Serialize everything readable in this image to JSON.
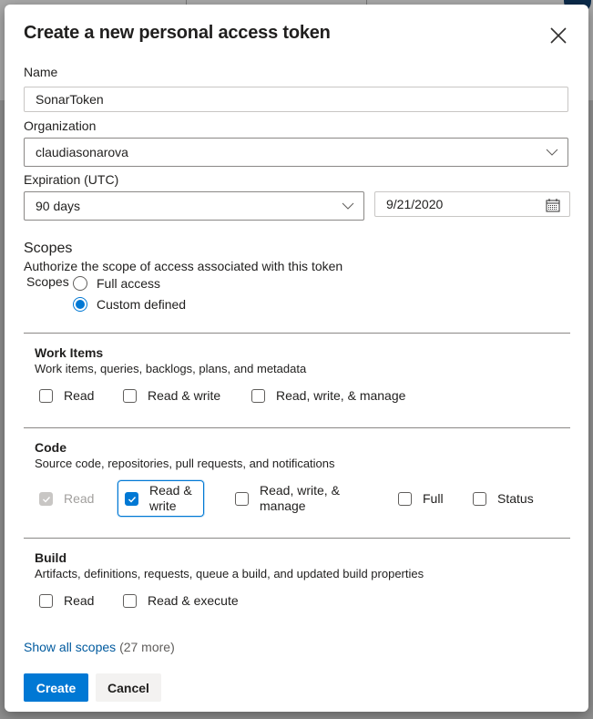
{
  "dialog": {
    "title": "Create a new personal access token",
    "close_icon": "close-icon"
  },
  "form": {
    "name_label": "Name",
    "name_value": "SonarToken",
    "organization_label": "Organization",
    "organization_value": "claudiasonarova",
    "expiration_label": "Expiration (UTC)",
    "expiration_value": "90 days",
    "expiration_date": "9/21/2020"
  },
  "scopes": {
    "heading": "Scopes",
    "description": "Authorize the scope of access associated with this token",
    "group_label": "Scopes",
    "options": [
      {
        "label": "Full access",
        "selected": false
      },
      {
        "label": "Custom defined",
        "selected": true
      }
    ]
  },
  "sections": [
    {
      "title": "Work Items",
      "description": "Work items, queries, backlogs, plans, and metadata",
      "checkboxes": [
        {
          "label": "Read",
          "checked": false,
          "disabled": false
        },
        {
          "label": "Read & write",
          "checked": false,
          "disabled": false
        },
        {
          "label": "Read, write, & manage",
          "checked": false,
          "disabled": false
        }
      ]
    },
    {
      "title": "Code",
      "description": "Source code, repositories, pull requests, and notifications",
      "checkboxes": [
        {
          "label": "Read",
          "checked": true,
          "disabled": true
        },
        {
          "label_line1": "Read &",
          "label_line2": "write",
          "checked": true,
          "disabled": false,
          "focused": true
        },
        {
          "label_line1": "Read, write, &",
          "label_line2": "manage",
          "checked": false,
          "disabled": false
        },
        {
          "label": "Full",
          "checked": false,
          "disabled": false
        },
        {
          "label": "Status",
          "checked": false,
          "disabled": false
        }
      ]
    },
    {
      "title": "Build",
      "description": "Artifacts, definitions, requests, queue a build, and updated build properties",
      "checkboxes": [
        {
          "label": "Read",
          "checked": false,
          "disabled": false
        },
        {
          "label": "Read & execute",
          "checked": false,
          "disabled": false
        }
      ]
    }
  ],
  "show_all": {
    "link": "Show all scopes",
    "count": "(27 more)"
  },
  "buttons": {
    "create": "Create",
    "cancel": "Cancel"
  },
  "colors": {
    "accent": "#0078d4",
    "link": "#005a9e"
  }
}
